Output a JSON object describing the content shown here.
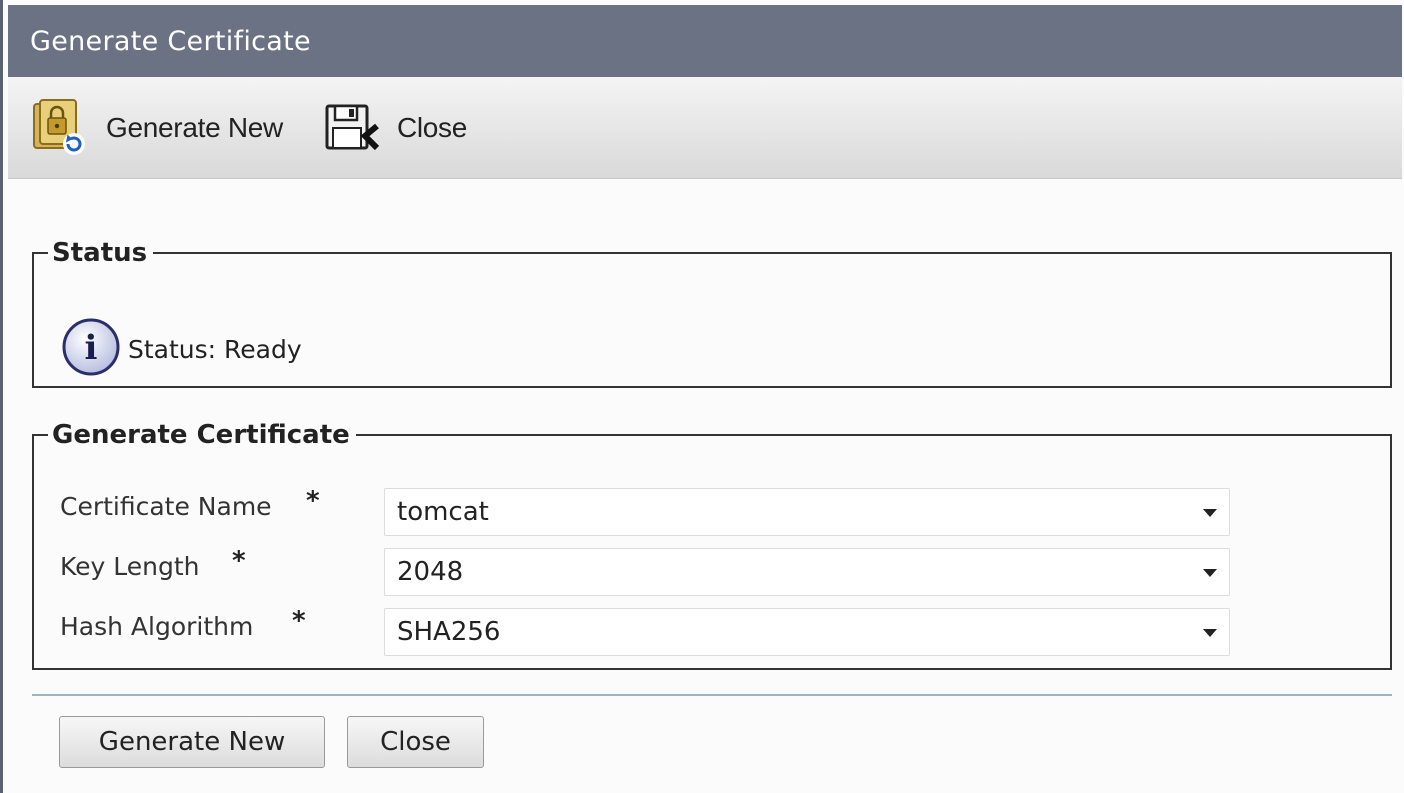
{
  "window": {
    "title": "Generate Certificate"
  },
  "toolbar": {
    "generate_label": "Generate New",
    "generate_icon": "certificate-lock-refresh-icon",
    "close_label": "Close",
    "close_icon": "save-close-icon"
  },
  "status": {
    "legend": "Status",
    "icon": "info-icon",
    "text": "Status: Ready"
  },
  "certificate": {
    "legend": "Generate Certificate",
    "fields": [
      {
        "label": "Certificate Name",
        "required": "*",
        "value": "tomcat"
      },
      {
        "label": "Key Length",
        "required": "*",
        "value": "2048"
      },
      {
        "label": "Hash Algorithm",
        "required": "*",
        "value": "SHA256"
      }
    ]
  },
  "buttons": {
    "generate_label": "Generate New",
    "close_label": "Close"
  },
  "colors": {
    "titlebar": "#6b7283",
    "divider": "#9fb3bf"
  }
}
